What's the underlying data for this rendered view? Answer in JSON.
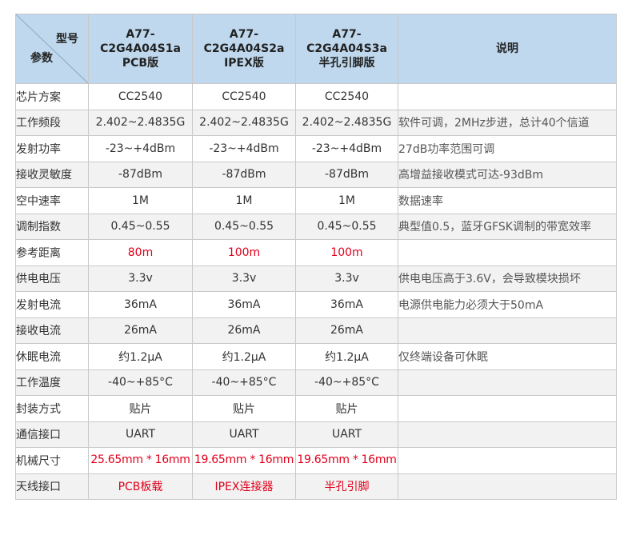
{
  "header": {
    "corner_top": "型号",
    "corner_bottom": "参数",
    "models": [
      [
        "A77-",
        "C2G4A04S1a",
        "PCB版"
      ],
      [
        "A77-",
        "C2G4A04S2a",
        "IPEX版"
      ],
      [
        "A77-",
        "C2G4A04S3a",
        "半孔引脚版"
      ]
    ],
    "note": "说明"
  },
  "rows": [
    {
      "param": "芯片方案",
      "v1": "CC2540",
      "v2": "CC2540",
      "v3": "CC2540",
      "note": ""
    },
    {
      "param": "工作频段",
      "v1": "2.402~2.4835G",
      "v2": "2.402~2.4835G",
      "v3": "2.402~2.4835G",
      "note": "软件可调，2MHz步进，总计40个信道"
    },
    {
      "param": "发射功率",
      "v1": "-23~+4dBm",
      "v2": "-23~+4dBm",
      "v3": "-23~+4dBm",
      "note": "27dB功率范围可调"
    },
    {
      "param": "接收灵敏度",
      "v1": "-87dBm",
      "v2": "-87dBm",
      "v3": "-87dBm",
      "note": "高增益接收模式可达-93dBm"
    },
    {
      "param": "空中速率",
      "v1": "1M",
      "v2": "1M",
      "v3": "1M",
      "note": "数据速率"
    },
    {
      "param": "调制指数",
      "v1": "0.45~0.55",
      "v2": "0.45~0.55",
      "v3": "0.45~0.55",
      "note": "典型值0.5，蓝牙GFSK调制的带宽效率"
    },
    {
      "param": "参考距离",
      "v1": "80m",
      "v2": "100m",
      "v3": "100m",
      "note": ""
    },
    {
      "param": "供电电压",
      "v1": "3.3v",
      "v2": "3.3v",
      "v3": "3.3v",
      "note": "供电电压高于3.6V，会导致模块损坏"
    },
    {
      "param": "发射电流",
      "v1": "36mA",
      "v2": "36mA",
      "v3": "36mA",
      "note": "电源供电能力必须大于50mA"
    },
    {
      "param": "接收电流",
      "v1": "26mA",
      "v2": "26mA",
      "v3": "26mA",
      "note": ""
    },
    {
      "param": "休眠电流",
      "v1": "约1.2μA",
      "v2": "约1.2μA",
      "v3": "约1.2μA",
      "note": "仅终端设备可休眠"
    },
    {
      "param": "工作温度",
      "v1": "-40~+85°C",
      "v2": "-40~+85°C",
      "v3": "-40~+85°C",
      "note": ""
    },
    {
      "param": "封装方式",
      "v1": "贴片",
      "v2": "贴片",
      "v3": "贴片",
      "note": ""
    },
    {
      "param": "通信接口",
      "v1": "UART",
      "v2": "UART",
      "v3": "UART",
      "note": ""
    },
    {
      "param": "机械尺寸",
      "v1": "25.65mm * 16mm",
      "v2": "19.65mm * 16mm",
      "v3": "19.65mm * 16mm",
      "note": ""
    },
    {
      "param": "天线接口",
      "v1": "PCB板载",
      "v2": "IPEX连接器",
      "v3": "半孔引脚",
      "note": ""
    }
  ],
  "colors": {
    "header_bg": "#bfd8ee",
    "highlight_text": "#e0001b",
    "border": "#c9c9c9",
    "stripe": "#f2f2f2"
  }
}
